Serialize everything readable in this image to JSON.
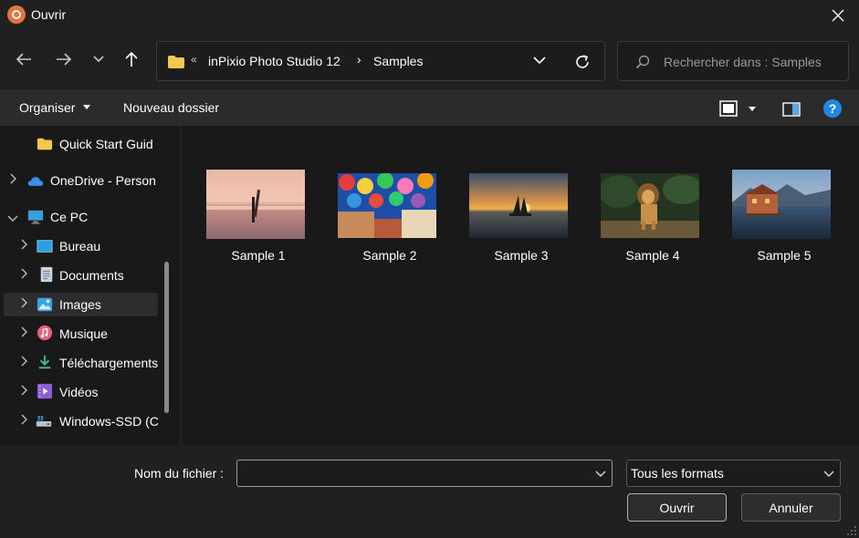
{
  "window": {
    "title": "Ouvrir"
  },
  "address": {
    "overflow": "«",
    "segments": [
      "inPixio Photo Studio 12",
      "Samples"
    ],
    "separator": "›"
  },
  "search": {
    "placeholder": "Rechercher dans : Samples"
  },
  "toolbar": {
    "organise_label": "Organiser",
    "new_folder_label": "Nouveau dossier",
    "help_label": "?"
  },
  "sidebar": {
    "items": [
      {
        "label": "Quick Start Guid",
        "icon": "folder-icon",
        "indent": 1,
        "expander": false
      },
      {
        "label": "OneDrive - Person",
        "icon": "cloud-icon",
        "indent": 0,
        "expander": "collapsed"
      },
      {
        "label": "Ce PC",
        "icon": "computer-icon",
        "indent": 0,
        "expander": "expanded"
      },
      {
        "label": "Bureau",
        "icon": "desktop-icon",
        "indent": 1,
        "expander": "collapsed"
      },
      {
        "label": "Documents",
        "icon": "document-icon",
        "indent": 1,
        "expander": "collapsed"
      },
      {
        "label": "Images",
        "icon": "pictures-icon",
        "indent": 1,
        "expander": "collapsed",
        "selected": true
      },
      {
        "label": "Musique",
        "icon": "music-icon",
        "indent": 1,
        "expander": "collapsed"
      },
      {
        "label": "Téléchargements",
        "icon": "download-icon",
        "indent": 1,
        "expander": "collapsed"
      },
      {
        "label": "Vidéos",
        "icon": "video-icon",
        "indent": 1,
        "expander": "collapsed"
      },
      {
        "label": "Windows-SSD (C",
        "icon": "drive-icon",
        "indent": 1,
        "expander": "collapsed"
      }
    ]
  },
  "files": [
    {
      "name": "Sample 1",
      "scene": "surfer-sunset"
    },
    {
      "name": "Sample 2",
      "scene": "umbrellas-street"
    },
    {
      "name": "Sample 3",
      "scene": "sailboat-sunset"
    },
    {
      "name": "Sample 4",
      "scene": "lion"
    },
    {
      "name": "Sample 5",
      "scene": "lake-house"
    }
  ],
  "bottom": {
    "filename_label": "Nom du fichier :",
    "filename_value": "",
    "format_value": "Tous les formats",
    "open_label": "Ouvrir",
    "cancel_label": "Annuler"
  },
  "colors": {
    "background": "#191919",
    "toolbar": "#2b2b2b",
    "accent": "#1e88e5",
    "app_icon": "#e8743b",
    "folder": "#f2c94c"
  }
}
